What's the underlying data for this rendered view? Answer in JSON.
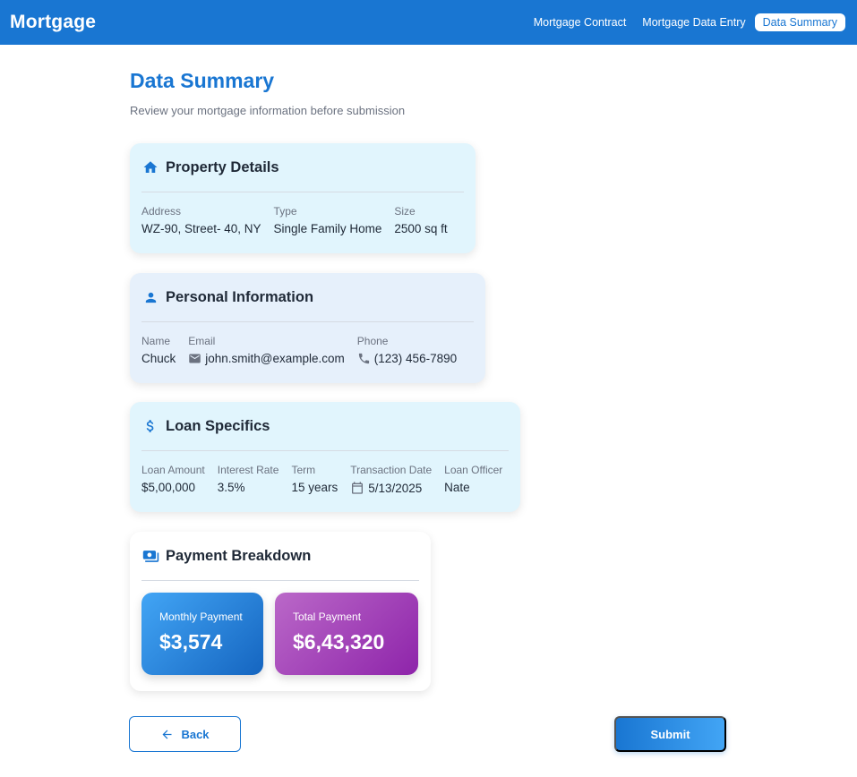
{
  "app": {
    "title": "Mortgage"
  },
  "nav": {
    "items": [
      {
        "label": "Mortgage Contract"
      },
      {
        "label": "Mortgage Data Entry"
      },
      {
        "label": "Data Summary",
        "active": true
      }
    ]
  },
  "page": {
    "title": "Data Summary",
    "subtitle": "Review your mortgage information before submission"
  },
  "property": {
    "title": "Property Details",
    "icon": "home-icon",
    "fields": [
      {
        "label": "Address",
        "value": "WZ-90, Street- 40, NY"
      },
      {
        "label": "Type",
        "value": "Single Family Home"
      },
      {
        "label": "Size",
        "value": "2500 sq ft"
      }
    ]
  },
  "personal": {
    "title": "Personal Information",
    "icon": "person-icon",
    "fields": [
      {
        "label": "Name",
        "value": "Chuck"
      },
      {
        "label": "Email",
        "value": "john.smith@example.com",
        "icon": "email-icon"
      },
      {
        "label": "Phone",
        "value": "(123) 456-7890",
        "icon": "phone-icon"
      }
    ]
  },
  "loan": {
    "title": "Loan Specifics",
    "icon": "dollar-icon",
    "fields": [
      {
        "label": "Loan Amount",
        "value": "$5,00,000"
      },
      {
        "label": "Interest Rate",
        "value": "3.5%"
      },
      {
        "label": "Term",
        "value": "15 years"
      },
      {
        "label": "Transaction Date",
        "value": "5/13/2025",
        "icon": "calendar-icon"
      },
      {
        "label": "Loan Officer",
        "value": "Nate"
      }
    ]
  },
  "payment": {
    "title": "Payment Breakdown",
    "icon": "payments-icon",
    "monthly": {
      "label": "Monthly Payment",
      "value": "$3,574"
    },
    "total": {
      "label": "Total Payment",
      "value": "$6,43,320"
    }
  },
  "actions": {
    "back_label": "Back",
    "submit_label": "Submit"
  },
  "colors": {
    "primary": "#1976d2",
    "monthly_gradient": [
      "#42a5f5",
      "#1565c0"
    ],
    "total_gradient": [
      "#ba68c8",
      "#8e24aa"
    ]
  }
}
